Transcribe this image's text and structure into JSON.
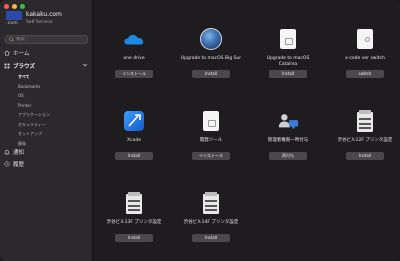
{
  "brand": {
    "logo_sub": ".com",
    "name": "kakaku.com",
    "service": "Self Service"
  },
  "search": {
    "placeholder": "検索"
  },
  "nav": {
    "home": "ホーム",
    "browse": "ブラウズ",
    "notifications": "通知",
    "history": "履歴"
  },
  "categories": [
    "すべて",
    "Bookmarks",
    "OS",
    "Printer",
    "アプリケーション",
    "セキュリティー",
    "セットアップ",
    "開発"
  ],
  "items": [
    {
      "title": "one drive",
      "button": "インストール"
    },
    {
      "title": "Upgrade to macOS Big Sur",
      "button": "Install"
    },
    {
      "title": "Upgrade to macOS Catalina",
      "button": "Install"
    },
    {
      "title": "x-code ver switch",
      "button": "switch"
    },
    {
      "title": "Xcode",
      "button": "Install"
    },
    {
      "title": "開発ツール",
      "button": "インストール"
    },
    {
      "title": "管理者権限一時付与",
      "button": "再付与"
    },
    {
      "title": "渋谷ビル12F プリンタ設定",
      "button": "Install"
    },
    {
      "title": "渋谷ビル13F プリンタ設定",
      "button": "Install"
    },
    {
      "title": "渋谷ビル14F プリンタ設定",
      "button": "Install"
    }
  ],
  "colors": {
    "accent_logo": "#2d4aa8",
    "onedrive": "#1e88e5",
    "xcode": "#1a73e8",
    "background": "#1e1c1e"
  }
}
